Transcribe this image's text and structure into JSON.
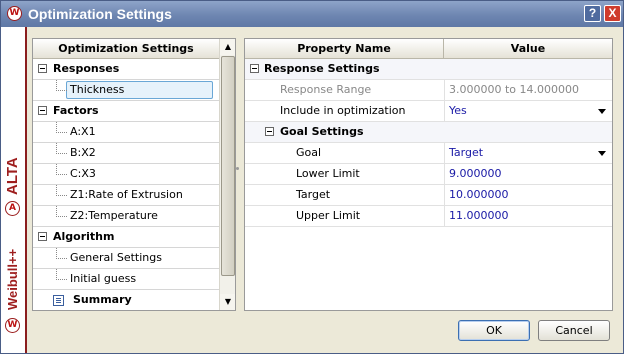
{
  "window": {
    "title": "Optimization Settings",
    "help_label": "?",
    "close_label": "X",
    "logo_letter": "W"
  },
  "sidebar": {
    "brand_weibull": "Weibull++",
    "brand_alta": "ALTA",
    "alta_logo_letter": "A"
  },
  "tree": {
    "header": "Optimization Settings",
    "sections": [
      {
        "label": "Responses",
        "items": [
          "Thickness"
        ]
      },
      {
        "label": "Factors",
        "items": [
          "A:X1",
          "B:X2",
          "C:X3",
          "Z1:Rate of Extrusion",
          "Z2:Temperature"
        ]
      },
      {
        "label": "Algorithm",
        "items": [
          "General Settings",
          "Initial guess"
        ]
      }
    ],
    "summary_label": "Summary",
    "selected_item": "Thickness"
  },
  "properties": {
    "header_name": "Property Name",
    "header_value": "Value",
    "response_settings": {
      "label": "Response Settings",
      "rows": [
        {
          "name": "Response Range",
          "value": "3.000000 to 14.000000"
        },
        {
          "name": "Include in optimization",
          "value": "Yes"
        }
      ]
    },
    "goal_settings": {
      "label": "Goal Settings",
      "rows": [
        {
          "name": "Goal",
          "value": "Target"
        },
        {
          "name": "Lower Limit",
          "value": "9.000000"
        },
        {
          "name": "Target",
          "value": "10.000000"
        },
        {
          "name": "Upper Limit",
          "value": "11.000000"
        }
      ]
    }
  },
  "buttons": {
    "ok": "OK",
    "cancel": "Cancel"
  },
  "colors": {
    "title_bar": "#6e86b1",
    "brand_red": "#9e1e1e",
    "value_blue": "#1a1aa6",
    "disabled_gray": "#888888",
    "selection_border": "#6aa7d6"
  }
}
